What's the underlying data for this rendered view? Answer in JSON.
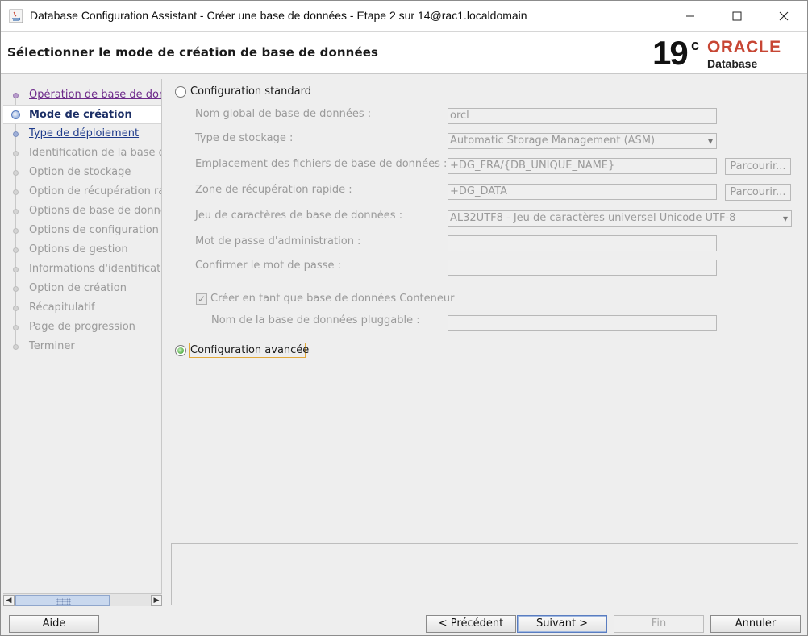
{
  "window": {
    "title": "Database Configuration Assistant - Créer une base de données - Etape 2 sur 14@rac1.localdomain",
    "minimize_icon": "minimize-icon",
    "maximize_icon": "maximize-icon",
    "close_icon": "close-icon"
  },
  "header": {
    "title": "Sélectionner le mode de création de base de données",
    "logo": {
      "version": "19",
      "version_sup": "c",
      "brand": "ORACLE",
      "product": "Database"
    }
  },
  "sidebar": {
    "steps": [
      {
        "label": "Opération de base de données",
        "state": "done"
      },
      {
        "label": "Mode de création",
        "state": "current"
      },
      {
        "label": "Type de déploiement",
        "state": "link"
      },
      {
        "label": "Identification de la base de données",
        "state": "pending"
      },
      {
        "label": "Option de stockage",
        "state": "pending"
      },
      {
        "label": "Option de récupération rapide",
        "state": "pending"
      },
      {
        "label": "Options de base de données",
        "state": "pending"
      },
      {
        "label": "Options de configuration",
        "state": "pending"
      },
      {
        "label": "Options de gestion",
        "state": "pending"
      },
      {
        "label": "Informations d'identification",
        "state": "pending"
      },
      {
        "label": "Option de création",
        "state": "pending"
      },
      {
        "label": "Récapitulatif",
        "state": "pending"
      },
      {
        "label": "Page de progression",
        "state": "pending"
      },
      {
        "label": "Terminer",
        "state": "pending"
      }
    ]
  },
  "standard": {
    "label": "Configuration standard",
    "selected": false,
    "global_name_label": "Nom global de base de données :",
    "global_name_value": "orcl",
    "storage_type_label": "Type de stockage :",
    "storage_type_value": "Automatic Storage Management (ASM)",
    "files_location_label": "Emplacement des fichiers de base de données :",
    "files_location_value": "+DG_FRA/{DB_UNIQUE_NAME}",
    "recovery_area_label": "Zone de récupération rapide :",
    "recovery_area_value": "+DG_DATA",
    "browse_label": "Parcourir...",
    "charset_label": "Jeu de caractères de base de données :",
    "charset_value": "AL32UTF8 - Jeu de caractères universel Unicode UTF-8",
    "admin_password_label": "Mot de passe d'administration :",
    "confirm_password_label": "Confirmer le mot de passe :",
    "container_label": "Créer en tant que base de données Conteneur",
    "container_checked": true,
    "pluggable_label": "Nom de la base de données pluggable :"
  },
  "advanced": {
    "label": "Configuration avancée",
    "selected": true
  },
  "footer": {
    "help": "Aide",
    "previous": "< Précédent",
    "next": "Suivant >",
    "finish": "Fin",
    "cancel": "Annuler"
  },
  "colors": {
    "oracle_red": "#c74634",
    "current_step": "#1c2f66",
    "link": "#1f3c8c",
    "visited": "#6d2a8a",
    "focus": "#e2a83a"
  }
}
